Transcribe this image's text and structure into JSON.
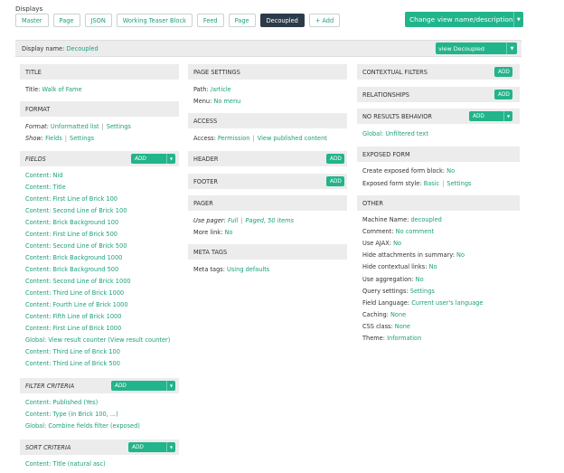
{
  "displays_label": "Displays",
  "tabs": [
    "Master",
    "Page",
    "JSON",
    "Working Teaser Block",
    "Feed",
    "Page",
    "Decoupled"
  ],
  "add_tab": {
    "icon": "plus-icon",
    "label": "Add"
  },
  "change_view_label": "Change view name/description",
  "display_name": {
    "label": "Display name:",
    "value": "Decoupled"
  },
  "view_select_label": "view Decoupled",
  "col1": {
    "title": {
      "header": "TITLE",
      "label": "Title:",
      "value": "Walk of Fame"
    },
    "format": {
      "header": "FORMAT",
      "format_label": "Format:",
      "format_value": "Unformatted list",
      "format_settings": "Settings",
      "show_label": "Show:",
      "show_value": "Fields",
      "show_settings": "Settings"
    },
    "fields": {
      "header": "FIELDS",
      "add": "Add",
      "items": [
        "Content: Nid",
        "Content: Title",
        "Content: First Line of Brick 100",
        "Content: Second Line of Brick 100",
        "Content: Brick Background 100",
        "Content: First Line of Brick 500",
        "Content: Second Line of Brick 500",
        "Content: Brick Background 1000",
        "Content: Brick Background 500",
        "Content: Second Line of Brick 1000",
        "Content: Third Line of Brick 1000",
        "Content: Fourth Line of Brick 1000",
        "Content: Fifth Line of Brick 1000",
        "Content: First Line of Brick 1000",
        "Global: View result counter (View result counter)",
        "Content: Third Line of Brick 100",
        "Content: Third Line of Brick 500"
      ]
    },
    "filter": {
      "header": "FILTER CRITERIA",
      "add": "Add",
      "items": [
        "Content: Published (Yes)",
        "Content: Type (in Brick 100, ...)",
        "Global: Combine fields filter (exposed)"
      ]
    },
    "sort": {
      "header": "SORT CRITERIA",
      "add": "Add",
      "items": [
        "Content: Title (natural asc)"
      ]
    }
  },
  "col2": {
    "page_settings": {
      "header": "PAGE SETTINGS",
      "path_label": "Path:",
      "path_value": "/article",
      "menu_label": "Menu:",
      "menu_value": "No menu"
    },
    "access": {
      "header": "ACCESS",
      "label": "Access:",
      "value": "Permission",
      "value2": "View published content"
    },
    "header": {
      "header": "HEADER",
      "add": "Add"
    },
    "footer": {
      "header": "FOOTER",
      "add": "Add"
    },
    "pager": {
      "header": "PAGER",
      "use_label": "Use pager:",
      "use_value": "Full",
      "use_value2": "Paged, 50 items",
      "more_label": "More link:",
      "more_value": "No"
    },
    "meta": {
      "header": "META TAGS",
      "label": "Meta tags:",
      "value": "Using defaults"
    }
  },
  "col3": {
    "contextual": {
      "header": "CONTEXTUAL FILTERS",
      "add": "Add"
    },
    "relationships": {
      "header": "RELATIONSHIPS",
      "add": "Add"
    },
    "no_results": {
      "header": "NO RESULTS BEHAVIOR",
      "add": "Add",
      "item": "Global: Unfiltered text"
    },
    "exposed": {
      "header": "EXPOSED FORM",
      "block_label": "Create exposed form block:",
      "block_value": "No",
      "style_label": "Exposed form style:",
      "style_value": "Basic",
      "style_settings": "Settings"
    },
    "other": {
      "header": "OTHER",
      "rows": [
        {
          "label": "Machine Name:",
          "value": "decoupled"
        },
        {
          "label": "Comment:",
          "value": "No comment"
        },
        {
          "label": "Use AJAX:",
          "value": "No"
        },
        {
          "label": "Hide attachments in summary:",
          "value": "No"
        },
        {
          "label": "Hide contextual links:",
          "value": "No"
        },
        {
          "label": "Use aggregation:",
          "value": "No"
        },
        {
          "label": "Query settings:",
          "value": "Settings"
        },
        {
          "label": "Field Language:",
          "value": "Current user's language"
        },
        {
          "label": "Caching:",
          "value": "None"
        },
        {
          "label": "CSS class:",
          "value": "None"
        },
        {
          "label": "Theme:",
          "value": "Information"
        }
      ]
    }
  }
}
